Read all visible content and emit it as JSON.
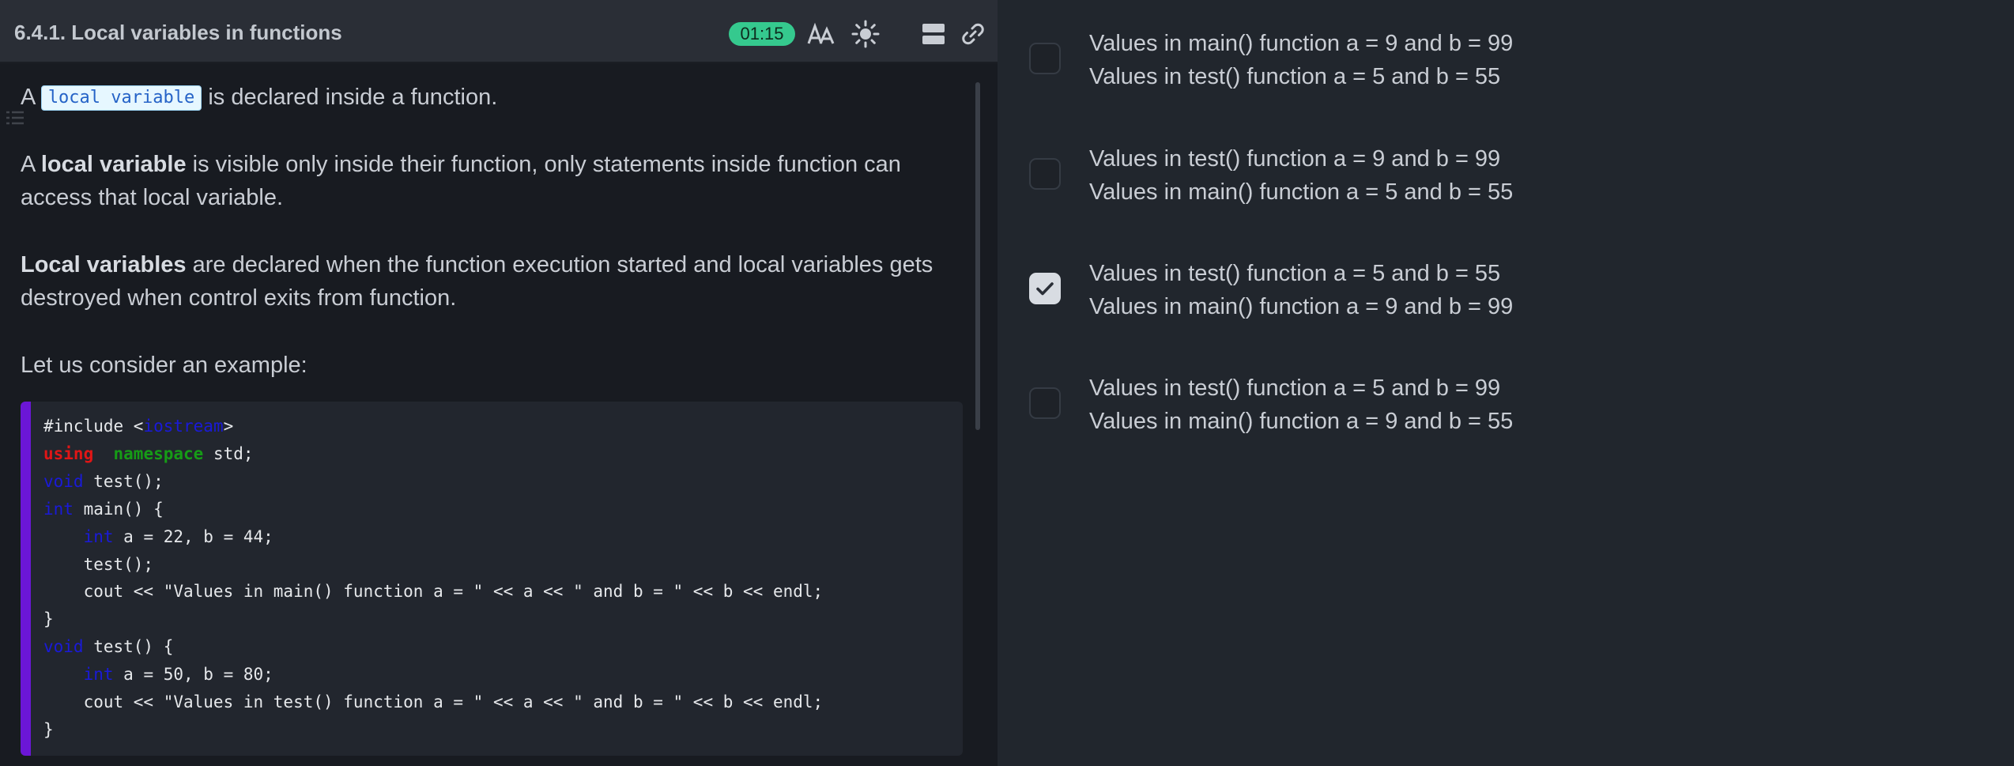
{
  "header": {
    "title": "6.4.1. Local variables in functions",
    "timer": "01:15",
    "icons": [
      "font-size-icon",
      "theme-sun-icon",
      "layout-icon",
      "link-icon"
    ]
  },
  "content": {
    "p1": {
      "before": "A",
      "code": "local variable",
      "after": "is declared inside a function."
    },
    "p2": {
      "bold": "local variable",
      "line1": "is visible only inside their function, only statements inside function can",
      "line2": "access that local variable.",
      "lead": "A"
    },
    "p3": {
      "bold": "Local variables",
      "line1": "are declared when the function execution started and local variables gets",
      "line2": "destroyed when control exits from function."
    },
    "p4": "Let us consider an example:"
  },
  "code": {
    "l1_a": "#include <",
    "l1_b": "iostream",
    "l1_c": ">",
    "l2_a": "using",
    "l2_b": "namespace",
    "l2_c": " std;",
    "l3_a": "void",
    "l3_b": " test();",
    "l4_a": "int",
    "l4_b": " main() {",
    "l5_a": "int",
    "l5_b": " a = 22, b = 44;",
    "l6": "    test();",
    "l7": "    cout << \"Values in main() function a = \" << a << \" and b = \" << b << endl;",
    "l8": "}",
    "l9_a": "void",
    "l9_b": " test() {",
    "l10_a": "int",
    "l10_b": " a = 50, b = 80;",
    "l11": "    cout << \"Values in test() function a = \" << a << \" and b = \" << b << endl;",
    "l12": "}"
  },
  "options": [
    {
      "line1": "Values in main() function a = 9 and b = 99",
      "line2": "Values in test() function a = 5 and b = 55",
      "checked": false
    },
    {
      "line1": "Values in test() function a = 9 and b = 99",
      "line2": "Values in main() function a = 5 and b = 55",
      "checked": false
    },
    {
      "line1": "Values in test() function a = 5 and b = 55",
      "line2": "Values in main() function a = 9 and b = 99",
      "checked": true
    },
    {
      "line1": "Values in test() function a = 5 and b = 99",
      "line2": "Values in main() function a = 9 and b = 55",
      "checked": false
    }
  ],
  "colors": {
    "timer": "#35c98e",
    "code_accent": "#6b16d6",
    "inline_code_bg": "#e6f7ff"
  }
}
